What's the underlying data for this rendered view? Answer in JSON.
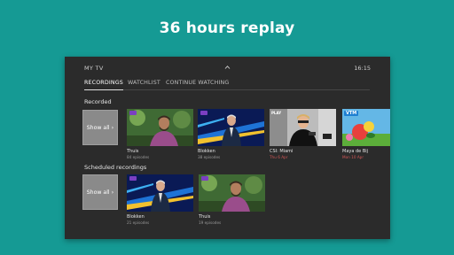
{
  "headline": "36 hours replay",
  "topbar": {
    "title": "MY TV",
    "time": "16:15"
  },
  "tabs": [
    {
      "label": "RECORDINGS",
      "active": true
    },
    {
      "label": "WATCHLIST",
      "active": false
    },
    {
      "label": "CONTINUE WATCHING",
      "active": false
    }
  ],
  "recorded": {
    "label": "Recorded",
    "show_all": "Show all",
    "items": [
      {
        "title": "Thuis",
        "sub": "84 episodes"
      },
      {
        "title": "Blokken",
        "sub": "38 episodes"
      },
      {
        "title": "CSI: Miami",
        "sub": "Thu 6 Apr",
        "channel": "PLAY"
      },
      {
        "title": "Maya de Bij",
        "sub": "Mon 10 Apr",
        "channel": "VTM"
      }
    ]
  },
  "scheduled": {
    "label": "Scheduled recordings",
    "show_all": "Show all",
    "items": [
      {
        "title": "Blokken",
        "sub": "21 episodes"
      },
      {
        "title": "Thuis",
        "sub": "19 episodes"
      }
    ]
  },
  "colors": {
    "background": "#159a94",
    "screen": "#2b2b2b",
    "show_all_tile": "#8a8a8a",
    "accent_text": "#ffffff"
  }
}
